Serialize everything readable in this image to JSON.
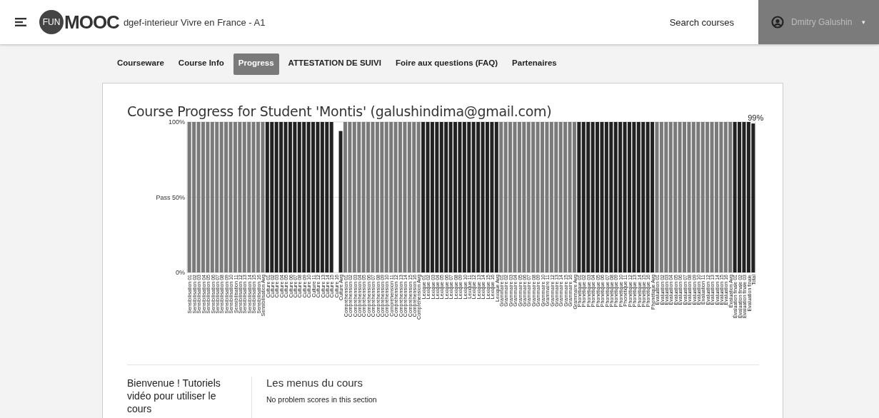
{
  "header": {
    "logo_badge": "FUN",
    "logo_word": "MOOC",
    "course_title": "dgef-interieur Vivre en France - A1",
    "search_link": "Search courses",
    "user_name": "Dmitry Galushin",
    "user_caret": "▾"
  },
  "tabs": [
    {
      "label": "Courseware",
      "selected": false
    },
    {
      "label": "Course Info",
      "selected": false
    },
    {
      "label": "Progress",
      "selected": true
    },
    {
      "label": "ATTESTATION DE SUIVI",
      "selected": false
    },
    {
      "label": "Foire aux questions (FAQ)",
      "selected": false
    },
    {
      "label": "Partenaires",
      "selected": false
    }
  ],
  "progress": {
    "title": "Course Progress for Student 'Montis' (galushindima@gmail.com)",
    "chart_data": {
      "type": "bar",
      "ylim": [
        0,
        100
      ],
      "yticks": [
        {
          "value": 0,
          "label": "0%"
        },
        {
          "value": 50,
          "label": "Pass 50%"
        },
        {
          "value": 100,
          "label": "100%"
        }
      ],
      "annotations": [
        {
          "x": "Total",
          "y": 99,
          "text": "99%"
        }
      ],
      "categories": [
        "Sensibilisation 01",
        "Sensibilisation 02",
        "Sensibilisation 03",
        "Sensibilisation 04",
        "Sensibilisation 05",
        "Sensibilisation 06",
        "Sensibilisation 07",
        "Sensibilisation 08",
        "Sensibilisation 09",
        "Sensibilisation 10",
        "Sensibilisation 11",
        "Sensibilisation 12",
        "Sensibilisation 13",
        "Sensibilisation 14",
        "Sensibilisation 15",
        "Sensibilisation 16",
        "Sensibilisation Avg",
        "Culture 01",
        "Culture 02",
        "Culture 03",
        "Culture 04",
        "Culture 05",
        "Culture 06",
        "Culture 07",
        "Culture 08",
        "Culture 09",
        "Culture 10",
        "Culture 11",
        "Culture 12",
        "Culture 13",
        "Culture 14",
        "Culture 15",
        "Culture 16",
        "Culture Avg",
        "Compréhension 01",
        "Compréhension 02",
        "Compréhension 03",
        "Compréhension 04",
        "Compréhension 05",
        "Compréhension 06",
        "Compréhension 07",
        "Compréhension 08",
        "Compréhension 09",
        "Compréhension 10",
        "Compréhension 11",
        "Compréhension 12",
        "Compréhension 13",
        "Compréhension 14",
        "Compréhension 15",
        "Compréhension 16",
        "Compréhension Avg",
        "Lexique 01",
        "Lexique 02",
        "Lexique 03",
        "Lexique 04",
        "Lexique 05",
        "Lexique 06",
        "Lexique 07",
        "Lexique 08",
        "Lexique 09",
        "Lexique 10",
        "Lexique 11",
        "Lexique 12",
        "Lexique 13",
        "Lexique 14",
        "Lexique 15",
        "Lexique 16",
        "Lexique Avg",
        "Grammaire 01",
        "Grammaire 02",
        "Grammaire 03",
        "Grammaire 04",
        "Grammaire 05",
        "Grammaire 06",
        "Grammaire 07",
        "Grammaire 08",
        "Grammaire 09",
        "Grammaire 10",
        "Grammaire 11",
        "Grammaire 12",
        "Grammaire 13",
        "Grammaire 14",
        "Grammaire 15",
        "Grammaire 16",
        "Grammaire Avg",
        "Phonétique 01",
        "Phonétique 02",
        "Phonétique 03",
        "Phonétique 04",
        "Phonétique 05",
        "Phonétique 06",
        "Phonétique 07",
        "Phonétique 08",
        "Phonétique 09",
        "Phonétique 10",
        "Phonétique 11",
        "Phonétique 12",
        "Phonétique 13",
        "Phonétique 14",
        "Phonétique 15",
        "Phonétique 16",
        "Phonétique Avg",
        "Évaluation 01",
        "Évaluation 02",
        "Évaluation 03",
        "Évaluation 04",
        "Évaluation 05",
        "Évaluation 06",
        "Évaluation 07",
        "Évaluation 08",
        "Évaluation 09",
        "Évaluation 10",
        "Évaluation 11",
        "Évaluation 12",
        "Évaluation 13",
        "Évaluation 14",
        "Évaluation 15",
        "Évaluation 16",
        "Évaluation Avg",
        "Évaluation finale 01",
        "Évaluation finale 02",
        "Évaluation finale 03",
        "Evaluation finale",
        "Total"
      ],
      "series": [
        {
          "color": "#7a7a7a",
          "values": [
            100,
            100,
            100,
            100,
            100,
            100,
            100,
            100,
            100,
            100,
            100,
            100,
            100,
            100,
            100,
            100,
            100,
            null,
            null,
            null,
            null,
            null,
            null,
            null,
            null,
            null,
            null,
            null,
            null,
            null,
            null,
            null,
            null,
            null,
            100,
            100,
            100,
            100,
            100,
            100,
            100,
            100,
            100,
            100,
            100,
            100,
            100,
            100,
            100,
            100,
            100,
            null,
            null,
            null,
            null,
            null,
            null,
            null,
            null,
            null,
            null,
            null,
            null,
            null,
            null,
            null,
            null,
            null,
            100,
            100,
            100,
            100,
            100,
            100,
            100,
            100,
            100,
            100,
            100,
            100,
            100,
            100,
            100,
            100,
            100,
            null,
            null,
            null,
            null,
            null,
            null,
            null,
            null,
            null,
            null,
            null,
            null,
            null,
            null,
            null,
            null,
            null,
            100,
            100,
            100,
            100,
            100,
            100,
            100,
            100,
            100,
            100,
            100,
            100,
            100,
            100,
            100,
            100,
            100,
            null,
            null,
            null,
            null,
            null
          ]
        },
        {
          "color": "#222222",
          "values": [
            null,
            null,
            null,
            null,
            null,
            null,
            null,
            null,
            null,
            null,
            null,
            null,
            null,
            null,
            null,
            null,
            null,
            100,
            100,
            100,
            100,
            100,
            100,
            100,
            100,
            100,
            100,
            100,
            100,
            100,
            100,
            100,
            null,
            94,
            null,
            null,
            null,
            null,
            null,
            null,
            null,
            null,
            null,
            null,
            null,
            null,
            null,
            null,
            null,
            null,
            null,
            100,
            100,
            100,
            100,
            100,
            100,
            100,
            100,
            100,
            100,
            100,
            100,
            100,
            100,
            100,
            100,
            100,
            null,
            null,
            null,
            null,
            null,
            null,
            null,
            null,
            null,
            null,
            null,
            null,
            null,
            null,
            null,
            null,
            null,
            100,
            100,
            100,
            100,
            100,
            100,
            100,
            100,
            100,
            100,
            100,
            100,
            100,
            100,
            100,
            100,
            100,
            null,
            null,
            null,
            null,
            null,
            null,
            null,
            null,
            null,
            null,
            null,
            null,
            null,
            null,
            null,
            null,
            null,
            100,
            100,
            100,
            100,
            99
          ]
        }
      ]
    }
  },
  "chapter": {
    "title": "Bienvenue ! Tutoriels vidéo pour utiliser le cours",
    "section_title": "Les menus du cours",
    "section_note": "No problem scores in this section"
  }
}
